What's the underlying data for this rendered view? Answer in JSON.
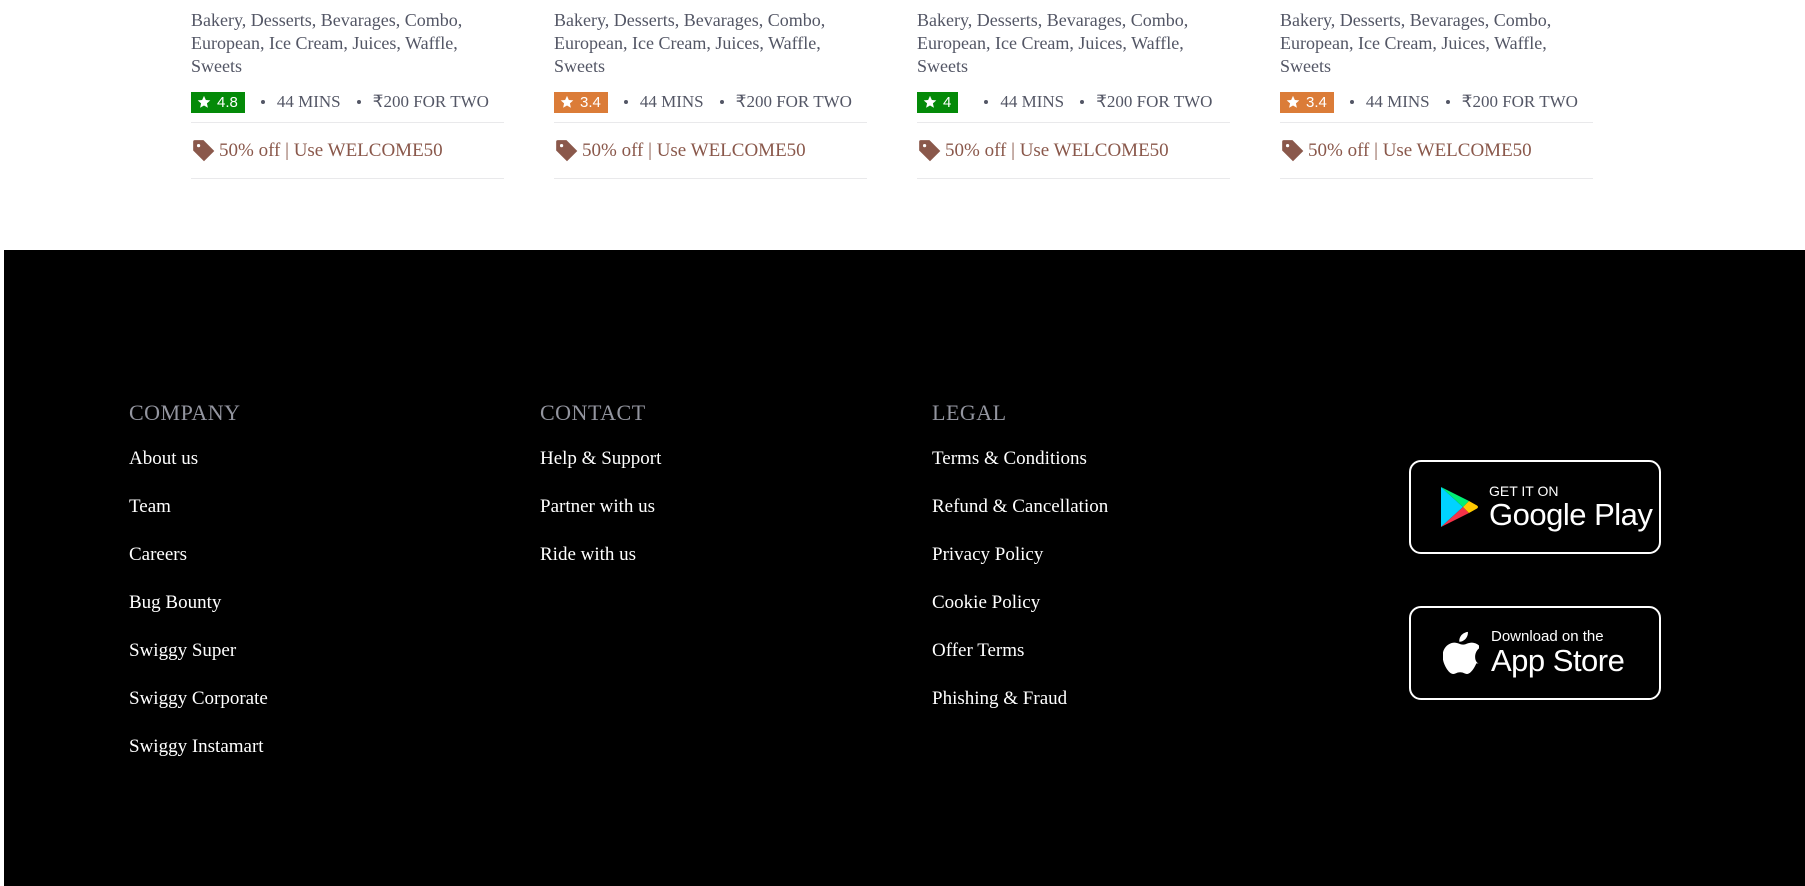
{
  "restaurants": [
    {
      "cuisines": "Bakery, Desserts, Bevarages, Combo, European, Ice Cream, Juices, Waffle, Sweets",
      "rating": "4.8",
      "rating_color": "#048a08",
      "time": "44 MINS",
      "cost": "₹200 FOR TWO",
      "offer": "50% off | Use WELCOME50"
    },
    {
      "cuisines": "Bakery, Desserts, Bevarages, Combo, European, Ice Cream, Juices, Waffle, Sweets",
      "rating": "3.4",
      "rating_color": "#db7c38",
      "time": "44 MINS",
      "cost": "₹200 FOR TWO",
      "offer": "50% off | Use WELCOME50"
    },
    {
      "cuisines": "Bakery, Desserts, Bevarages, Combo, European, Ice Cream, Juices, Waffle, Sweets",
      "rating": "4",
      "rating_color": "#048a08",
      "time": "44 MINS",
      "cost": "₹200 FOR TWO",
      "offer": "50% off | Use WELCOME50"
    },
    {
      "cuisines": "Bakery, Desserts, Bevarages, Combo, European, Ice Cream, Juices, Waffle, Sweets",
      "rating": "3.4",
      "rating_color": "#db7c38",
      "time": "44 MINS",
      "cost": "₹200 FOR TWO",
      "offer": "50% off | Use WELCOME50"
    }
  ],
  "icons": {
    "rating": "star-icon",
    "offer": "offer-tag-icon",
    "google_play": "google-play-icon",
    "app_store": "apple-icon"
  },
  "colors": {
    "offer_text": "#8a584b",
    "footer_bg": "#000000",
    "heading": "#93959f"
  },
  "footer": {
    "company": {
      "heading": "COMPANY",
      "links": [
        "About us",
        "Team",
        "Careers",
        "Bug Bounty",
        "Swiggy Super",
        "Swiggy Corporate",
        "Swiggy Instamart"
      ]
    },
    "contact": {
      "heading": "CONTACT",
      "links": [
        "Help & Support",
        "Partner with us",
        "Ride with us"
      ]
    },
    "legal": {
      "heading": "LEGAL",
      "links": [
        "Terms & Conditions",
        "Refund & Cancellation",
        "Privacy Policy",
        "Cookie Policy",
        "Offer Terms",
        "Phishing & Fraud"
      ]
    },
    "google_play": {
      "small": "GET IT ON",
      "big": "Google Play"
    },
    "app_store": {
      "small": "Download on the",
      "big": "App Store"
    }
  }
}
